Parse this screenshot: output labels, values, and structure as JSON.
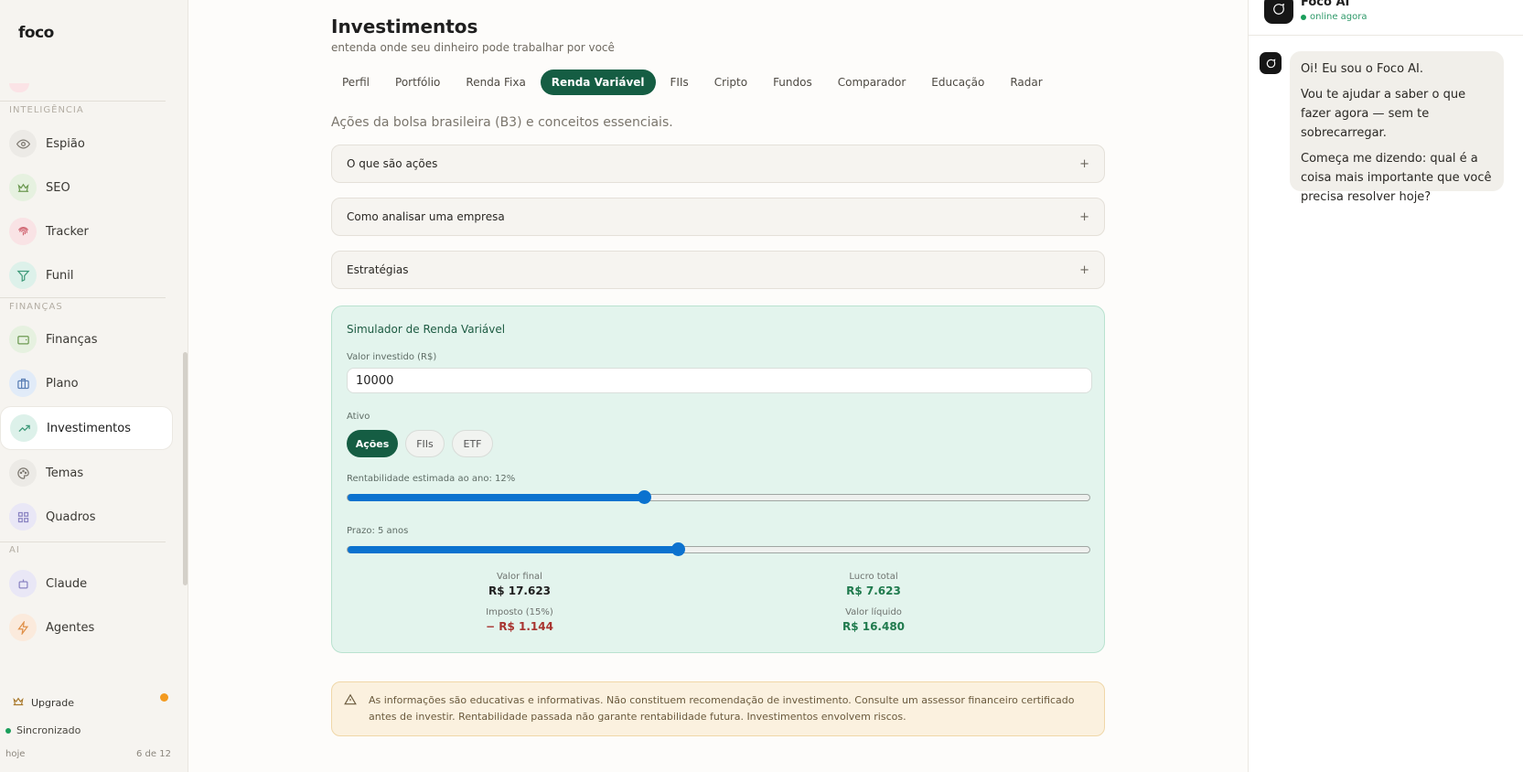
{
  "sidebar": {
    "logo": "foco",
    "sections": {
      "inteligencia": "INTELIGÊNCIA",
      "financas": "FINANÇAS",
      "ai": "AI"
    },
    "items": [
      {
        "label": "Espião",
        "icon": "eye-icon",
        "color": "#eceae6"
      },
      {
        "label": "SEO",
        "icon": "crown-icon",
        "color": "#e6f1e0"
      },
      {
        "label": "Tracker",
        "icon": "fingerprint-icon",
        "color": "#f9e3e5"
      },
      {
        "label": "Funil",
        "icon": "funnel-icon",
        "color": "#ddf1ea"
      },
      {
        "label": "Finanças",
        "icon": "wallet-icon",
        "color": "#e6f1e0"
      },
      {
        "label": "Plano",
        "icon": "briefcase-icon",
        "color": "#e1ebf8"
      },
      {
        "label": "Investimentos",
        "icon": "trending-up-icon",
        "color": "#ddf1ea"
      },
      {
        "label": "Temas",
        "icon": "palette-icon",
        "color": "#eceae6"
      },
      {
        "label": "Quadros",
        "icon": "grid-icon",
        "color": "#e9e7f6"
      },
      {
        "label": "Claude",
        "icon": "bot-icon",
        "color": "#e9e7f6"
      },
      {
        "label": "Agentes",
        "icon": "bolt-icon",
        "color": "#fbeadc"
      }
    ],
    "upgrade": "Upgrade",
    "sync": "Sincronizado",
    "today": "hoje",
    "count": "6 de 12"
  },
  "main": {
    "title": "Investimentos",
    "subtitle": "entenda onde seu dinheiro pode trabalhar por você",
    "tabs": [
      "Perfil",
      "Portfólio",
      "Renda Fixa",
      "Renda Variável",
      "FIIs",
      "Cripto",
      "Fundos",
      "Comparador",
      "Educação",
      "Radar"
    ],
    "active_tab": "Renda Variável",
    "intro": "Ações da bolsa brasileira (B3) e conceitos essenciais.",
    "accordions": [
      "O que são ações",
      "Como analisar uma empresa",
      "Estratégias"
    ],
    "accordion_toggle": "+"
  },
  "simulator": {
    "title": "Simulador de Renda Variável",
    "amount_label": "Valor investido (R$)",
    "amount_value": "10000",
    "asset_label": "Ativo",
    "assets": [
      "Ações",
      "FIIs",
      "ETF"
    ],
    "selected_asset": "Ações",
    "return_label": "Rentabilidade estimada ao ano: 12%",
    "return_fraction": 0.4,
    "term_label": "Prazo: 5 anos",
    "term_fraction": 0.445,
    "stats": {
      "final_label": "Valor final",
      "final_value": "R$ 17.623",
      "profit_label": "Lucro total",
      "profit_value": "R$ 7.623",
      "tax_label": "Imposto (15%)",
      "tax_value": "− R$ 1.144",
      "net_label": "Valor líquido",
      "net_value": "R$ 16.480"
    }
  },
  "disclaimer": "As informações são educativas e informativas. Não constituem recomendação de investimento. Consulte um assessor financeiro certificado antes de investir. Rentabilidade passada não garante rentabilidade futura. Investimentos envolvem riscos.",
  "chat": {
    "name": "Foco AI",
    "status": "online agora",
    "messages": [
      "Oi! Eu sou o Foco AI.",
      "Vou te ajudar a saber o que fazer agora — sem te sobrecarregar.",
      "Começa me dizendo: qual é a coisa mais importante que você precisa resolver hoje?"
    ]
  },
  "colors": {
    "accent": "#155d43",
    "slider": "#0b72cf",
    "profit": "#1f7a4d",
    "tax": "#a8332f"
  }
}
